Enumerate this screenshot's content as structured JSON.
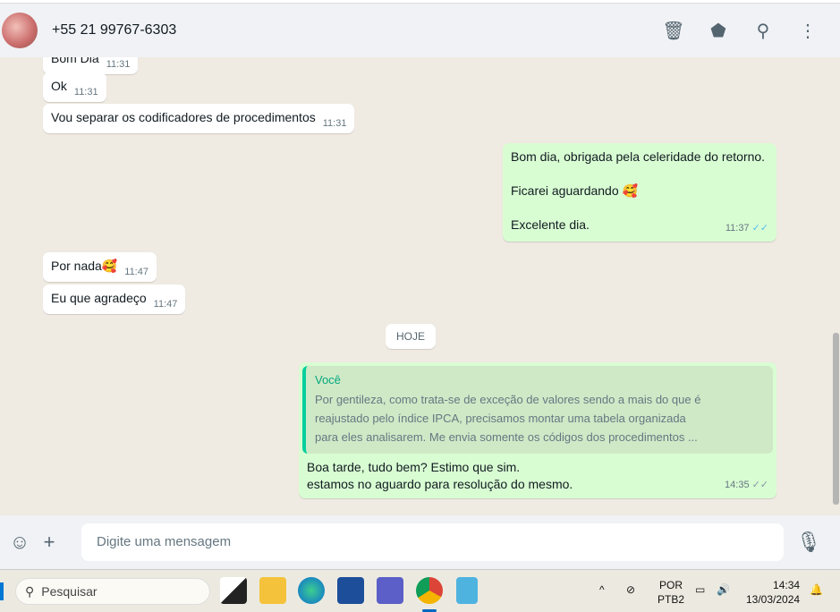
{
  "header": {
    "contact": "+55 21 99767-6303",
    "icons": [
      "trash-icon",
      "label-icon",
      "search-icon",
      "menu-icon"
    ]
  },
  "messages": [
    {
      "text": "Bom Dia",
      "time": "11:31"
    },
    {
      "text": "Ok",
      "time": "11:31"
    },
    {
      "text": "Vou separar os codificadores de procedimentos",
      "time": "11:31"
    },
    {
      "lines": [
        "Bom dia, obrigada pela celeridade do retorno.",
        "Ficarei aguardando 🥰",
        "Excelente dia."
      ],
      "time": "11:37"
    },
    {
      "text": "Por nada🥰",
      "time": "11:47"
    },
    {
      "text": "Eu que agradeço",
      "time": "11:47"
    }
  ],
  "day_separator": "HOJE",
  "reply": {
    "quote_author": "Você",
    "quote_lines": [
      "Por gentileza, como trata-se de exceção de valores sendo a mais do que é",
      "reajustado pelo índice IPCA, precisamos montar uma tabela organizada",
      "para eles analisarem. Me envia somente os códigos dos procedimentos ..."
    ],
    "lines": [
      "Boa tarde, tudo bem? Estimo que sim.",
      "estamos no aguardo para resolução do mesmo."
    ],
    "time": "14:35"
  },
  "composer": {
    "placeholder": "Digite uma mensagem"
  },
  "taskbar": {
    "search": "Pesquisar",
    "lang1": "POR",
    "lang2": "PTB2",
    "time": "14:34",
    "date": "13/03/2024"
  }
}
